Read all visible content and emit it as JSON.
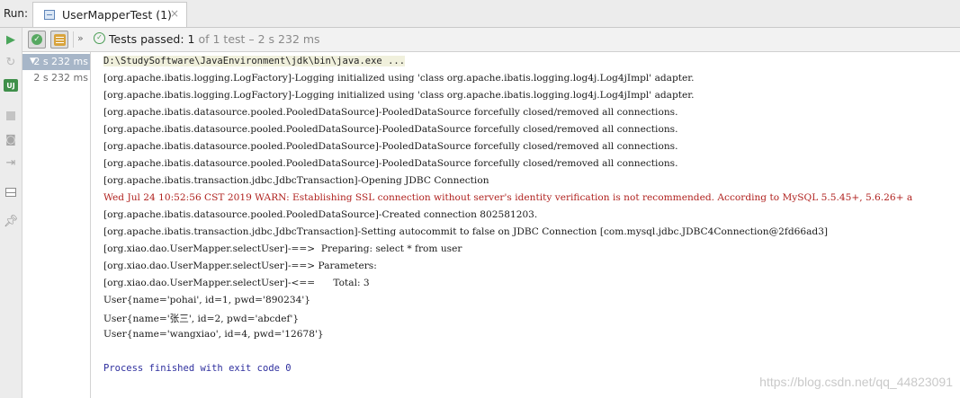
{
  "window": {
    "run_label": "Run:",
    "tab_title": "UserMapperTest (1)",
    "tab_close": "×"
  },
  "toolbar": {
    "status_label": "Tests passed:",
    "status_count": "1",
    "status_rest": "of 1 test – 2 s 232 ms"
  },
  "left_toolbar": {
    "toggle_icon_text": "UJ"
  },
  "tree": {
    "root_time": "2 s 232 ms",
    "child_time": "2 s 232 ms"
  },
  "console": {
    "lines": [
      "D:\\StudySoftware\\JavaEnvironment\\jdk\\bin\\java.exe ...",
      "[org.apache.ibatis.logging.LogFactory]-Logging initialized using 'class org.apache.ibatis.logging.log4j.Log4jImpl' adapter.",
      "[org.apache.ibatis.logging.LogFactory]-Logging initialized using 'class org.apache.ibatis.logging.log4j.Log4jImpl' adapter.",
      "[org.apache.ibatis.datasource.pooled.PooledDataSource]-PooledDataSource forcefully closed/removed all connections.",
      "[org.apache.ibatis.datasource.pooled.PooledDataSource]-PooledDataSource forcefully closed/removed all connections.",
      "[org.apache.ibatis.datasource.pooled.PooledDataSource]-PooledDataSource forcefully closed/removed all connections.",
      "[org.apache.ibatis.datasource.pooled.PooledDataSource]-PooledDataSource forcefully closed/removed all connections.",
      "[org.apache.ibatis.transaction.jdbc.JdbcTransaction]-Opening JDBC Connection",
      "Wed Jul 24 10:52:56 CST 2019 WARN: Establishing SSL connection without server's identity verification is not recommended. According to MySQL 5.5.45+, 5.6.26+ a",
      "[org.apache.ibatis.datasource.pooled.PooledDataSource]-Created connection 802581203.",
      "[org.apache.ibatis.transaction.jdbc.JdbcTransaction]-Setting autocommit to false on JDBC Connection [com.mysql.jdbc.JDBC4Connection@2fd66ad3]",
      "[org.xiao.dao.UserMapper.selectUser]-==>  Preparing: select * from user",
      "[org.xiao.dao.UserMapper.selectUser]-==> Parameters: ",
      "[org.xiao.dao.UserMapper.selectUser]-<==      Total: 3",
      "User{name='pohai', id=1, pwd='890234'}",
      "User{name='张三', id=2, pwd='abcdef'}",
      "User{name='wangxiao', id=4, pwd='12678'}",
      "",
      "Process finished with exit code 0"
    ]
  },
  "watermark": "https://blog.csdn.net/qq_44823091"
}
